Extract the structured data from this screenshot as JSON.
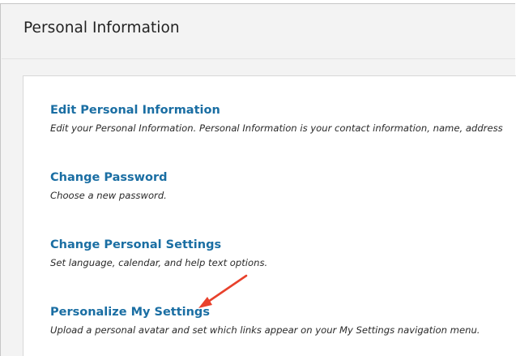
{
  "page": {
    "title": "Personal Information"
  },
  "items": [
    {
      "title": "Edit Personal Information",
      "description": "Edit your Personal Information. Personal Information is your contact information, name, address"
    },
    {
      "title": "Change Password",
      "description": "Choose a new password."
    },
    {
      "title": "Change Personal Settings",
      "description": "Set language, calendar, and help text options."
    },
    {
      "title": "Personalize My Settings",
      "description": "Upload a personal avatar and set which links appear on your My Settings navigation menu."
    }
  ],
  "annotation": {
    "icon": "arrow-icon",
    "color": "#e8412c"
  },
  "colors": {
    "link": "#1a6ea3",
    "header_background": "#f3f3f3",
    "panel_background": "#ffffff"
  }
}
